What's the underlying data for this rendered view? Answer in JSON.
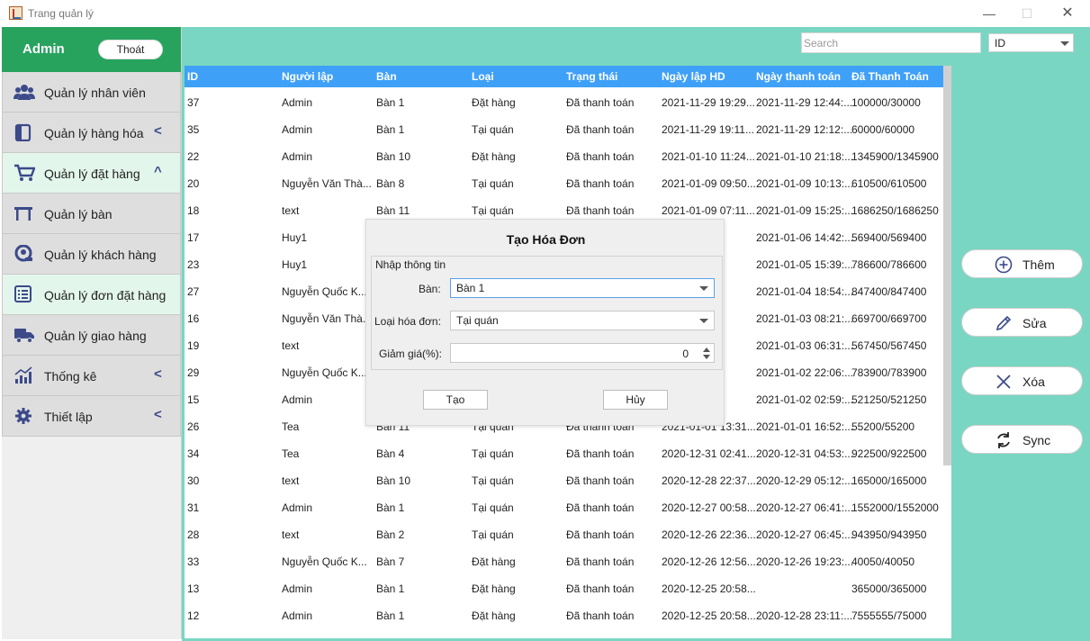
{
  "window": {
    "title": "Trang quản lý",
    "min": "—",
    "max": "☐",
    "close": "✕"
  },
  "sidebar": {
    "user": "Admin",
    "logout": "Thoát",
    "items": [
      {
        "label": "Quản lý nhân viên",
        "icon": "users-icon",
        "chevron": ""
      },
      {
        "label": "Quản lý hàng hóa",
        "icon": "product-icon",
        "chevron": "<"
      },
      {
        "label": "Quản lý đặt hàng",
        "icon": "cart-icon",
        "chevron": "^"
      },
      {
        "label": "Quản lý bàn",
        "icon": "table-icon",
        "chevron": ""
      },
      {
        "label": "Quản lý khách hàng",
        "icon": "customer-icon",
        "chevron": ""
      },
      {
        "label": "Quản lý đơn đặt hàng",
        "icon": "order-list-icon",
        "chevron": ""
      },
      {
        "label": "Quản lý giao hàng",
        "icon": "truck-icon",
        "chevron": ""
      },
      {
        "label": "Thống kê",
        "icon": "chart-icon",
        "chevron": "<"
      },
      {
        "label": "Thiết lập",
        "icon": "gear-icon",
        "chevron": "<"
      }
    ]
  },
  "toolbar": {
    "search_placeholder": "Search",
    "filter_value": "ID"
  },
  "table": {
    "columns": [
      "ID",
      "Người lập",
      "Bàn",
      "Loại",
      "Trạng thái",
      "Ngày lập HD",
      "Ngày thanh toán",
      "Đã Thanh Toán"
    ],
    "rows": [
      [
        "37",
        "Admin",
        "Bàn 1",
        "Đặt hàng",
        "Đã thanh toán",
        "2021-11-29 19:29...",
        "2021-11-29 12:44:...",
        "100000/30000"
      ],
      [
        "35",
        "Admin",
        "Bàn 1",
        "Tại quán",
        "Đã thanh toán",
        "2021-11-29 19:11...",
        "2021-11-29 12:12:...",
        "60000/60000"
      ],
      [
        "22",
        "Admin",
        "Bàn 10",
        "Đặt hàng",
        "Đã thanh toán",
        "2021-01-10 11:24...",
        "2021-01-10 21:18:...",
        "1345900/1345900"
      ],
      [
        "20",
        "Nguyễn Văn Thà...",
        "Bàn 8",
        "Tại quán",
        "Đã thanh toán",
        "2021-01-09 09:50...",
        "2021-01-09 10:13:...",
        "610500/610500"
      ],
      [
        "18",
        "text",
        "Bàn 11",
        "Tại quán",
        "Đã thanh toán",
        "2021-01-09 07:11...",
        "2021-01-09 15:25:...",
        "1686250/1686250"
      ],
      [
        "17",
        "Huy1",
        "",
        "",
        "",
        "7:54...",
        "2021-01-06 14:42:...",
        "569400/569400"
      ],
      [
        "23",
        "Huy1",
        "",
        "",
        "",
        "0:17...",
        "2021-01-05 15:39:...",
        "786600/786600"
      ],
      [
        "27",
        "Nguyễn Quốc K...",
        "",
        "",
        "",
        "7:03...",
        "2021-01-04 18:54:...",
        "847400/847400"
      ],
      [
        "16",
        "Nguyễn Văn Thà...",
        "",
        "",
        "",
        "6:13...",
        "2021-01-03 08:21:...",
        "669700/669700"
      ],
      [
        "19",
        "text",
        "",
        "",
        "",
        ":06...",
        "2021-01-03 06:31:...",
        "567450/567450"
      ],
      [
        "29",
        "Nguyễn Quốc K...",
        "",
        "",
        "",
        "7:58...",
        "2021-01-02 22:06:...",
        "783900/783900"
      ],
      [
        "15",
        "Admin",
        "",
        "",
        "",
        "6:14...",
        "2021-01-02 02:59:...",
        "521250/521250"
      ],
      [
        "26",
        "Tea",
        "Bàn 11",
        "Tại quán",
        "Đã thanh toán",
        "2021-01-01 13:31...",
        "2021-01-01 16:52:...",
        "55200/55200"
      ],
      [
        "34",
        "Tea",
        "Bàn 4",
        "Tại quán",
        "Đã thanh toán",
        "2020-12-31 02:41...",
        "2020-12-31 04:53:...",
        "922500/922500"
      ],
      [
        "30",
        "text",
        "Bàn 10",
        "Tại quán",
        "Đã thanh toán",
        "2020-12-28 22:37...",
        "2020-12-29 05:12:...",
        "165000/165000"
      ],
      [
        "31",
        "Admin",
        "Bàn 1",
        "Tại quán",
        "Đã thanh toán",
        "2020-12-27 00:58...",
        "2020-12-27 06:41:...",
        "1552000/1552000"
      ],
      [
        "28",
        "text",
        "Bàn 2",
        "Tại quán",
        "Đã thanh toán",
        "2020-12-26 22:36...",
        "2020-12-27 06:45:...",
        "943950/943950"
      ],
      [
        "33",
        "Nguyễn Quốc K...",
        "Bàn 7",
        "Đặt hàng",
        "Đã thanh toán",
        "2020-12-26 12:56...",
        "2020-12-26 19:23:...",
        "40050/40050"
      ],
      [
        "13",
        "Admin",
        "Bàn 1",
        "Đặt hàng",
        "Đã thanh toán",
        "2020-12-25 20:58...",
        "",
        "365000/365000"
      ],
      [
        "12",
        "Admin",
        "Bàn 1",
        "Đặt hàng",
        "Đã thanh toán",
        "2020-12-25 20:58...",
        "2020-12-28 23:11:...",
        "7555555/75000"
      ]
    ]
  },
  "actions": [
    {
      "label": "Thêm",
      "icon": "plus-circle-icon"
    },
    {
      "label": "Sửa",
      "icon": "pencil-icon"
    },
    {
      "label": "Xóa",
      "icon": "close-icon"
    },
    {
      "label": "Sync",
      "icon": "sync-icon"
    }
  ],
  "dialog": {
    "title": "Tạo Hóa Đơn",
    "group_label": "Nhập thông tin",
    "table_label": "Bàn:",
    "table_value": "Bàn 1",
    "type_label": "Loại hóa đơn:",
    "type_value": "Tại quán",
    "discount_label": "Giảm giá(%):",
    "discount_value": "0",
    "create_button": "Tạo",
    "cancel_button": "Hủy"
  },
  "colors": {
    "sidebar_head": "#27a35e",
    "content_bg": "#79d6c2",
    "table_header": "#3fa0f7"
  }
}
